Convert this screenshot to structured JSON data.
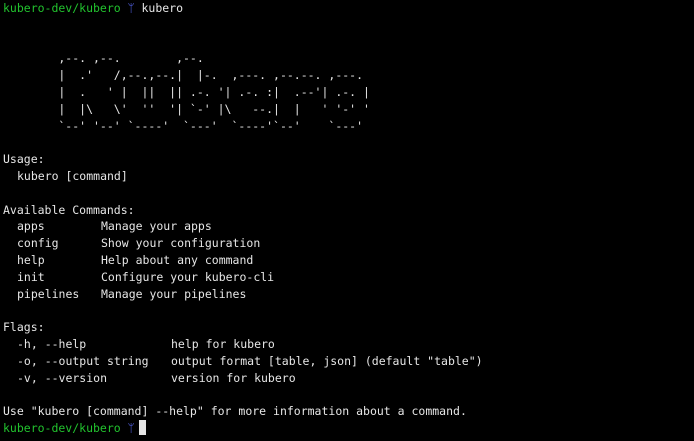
{
  "prompt": {
    "cwd": "kubero-dev/kubero",
    "glyph": "ᛘ",
    "command": "kubero"
  },
  "banner": [
    "        ,--. ,--.        ,--.",
    "        |  .'   /,--.,--.|  |-.  ,---. ,--.--. ,---.",
    "        |  .   ' |  ||  || .-. '| .-. :|  .--'| .-. |",
    "        |  |\\   \\'  ''  '| `-' |\\   --.|  |   ' '-' '",
    "        `--' '--' `----'  `---'  `----'`--'    `---'"
  ],
  "usage": {
    "heading": "Usage:",
    "line": "kubero [command]"
  },
  "commands": {
    "heading": "Available Commands:",
    "items": [
      {
        "name": "apps",
        "desc": "Manage your apps"
      },
      {
        "name": "config",
        "desc": "Show your configuration"
      },
      {
        "name": "help",
        "desc": "Help about any command"
      },
      {
        "name": "init",
        "desc": "Configure your kubero-cli"
      },
      {
        "name": "pipelines",
        "desc": "Manage your pipelines"
      }
    ]
  },
  "flags": {
    "heading": "Flags:",
    "items": [
      {
        "name": "-h, --help",
        "desc": "help for kubero"
      },
      {
        "name": "-o, --output string",
        "desc": "output format [table, json] (default \"table\")"
      },
      {
        "name": "-v, --version",
        "desc": "version for kubero"
      }
    ]
  },
  "footer": "Use \"kubero [command] --help\" for more information about a command.",
  "colors": {
    "background": "#000000",
    "text": "#e6e6e6",
    "cwd": "#22c32e",
    "glyph": "#5b6cff"
  }
}
